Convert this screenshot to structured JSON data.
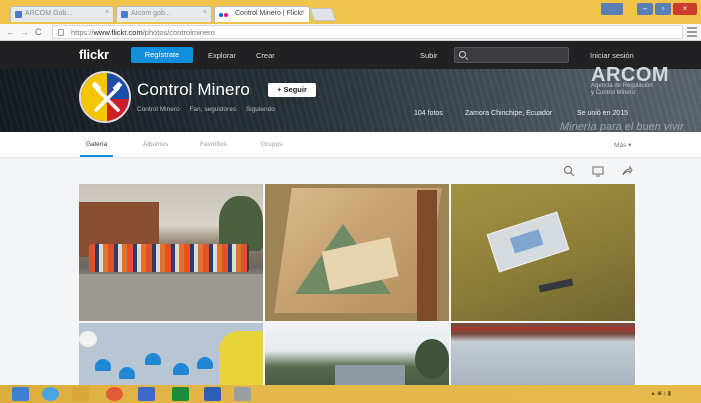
{
  "browser": {
    "tabs": [
      {
        "label": "ARCOM Gob..."
      },
      {
        "label": "Arcom gob..."
      },
      {
        "label": "Control Minero | Flickr"
      }
    ],
    "url_prefix": "https://",
    "url_host": "www.flickr.com",
    "url_path": "/photos/controlminero"
  },
  "flickr_nav": {
    "logo": "flickr",
    "register": "Regístrate",
    "explore": "Explorar",
    "create": "Crear",
    "upload": "Subir",
    "login": "Iniciar sesión"
  },
  "profile": {
    "name": "Control Minero",
    "follow": "+ Seguir",
    "username": "Control Minero",
    "followers": "Fan, seguidores",
    "following": "Siguiendo",
    "photo_count": "104 fotos",
    "location": "Zamora Chinchipe, Ecuador",
    "joined": "Se unió en 2015"
  },
  "cover": {
    "org_name": "ARCOM",
    "org_sub_1": "Agencia de Regulación",
    "org_sub_2": "y Control Minero",
    "slogan": "Minería para el buen vivir"
  },
  "subnav": {
    "tabs": [
      "Galería",
      "Álbumes",
      "Favoritos",
      "Grupos"
    ],
    "more": "Más"
  }
}
